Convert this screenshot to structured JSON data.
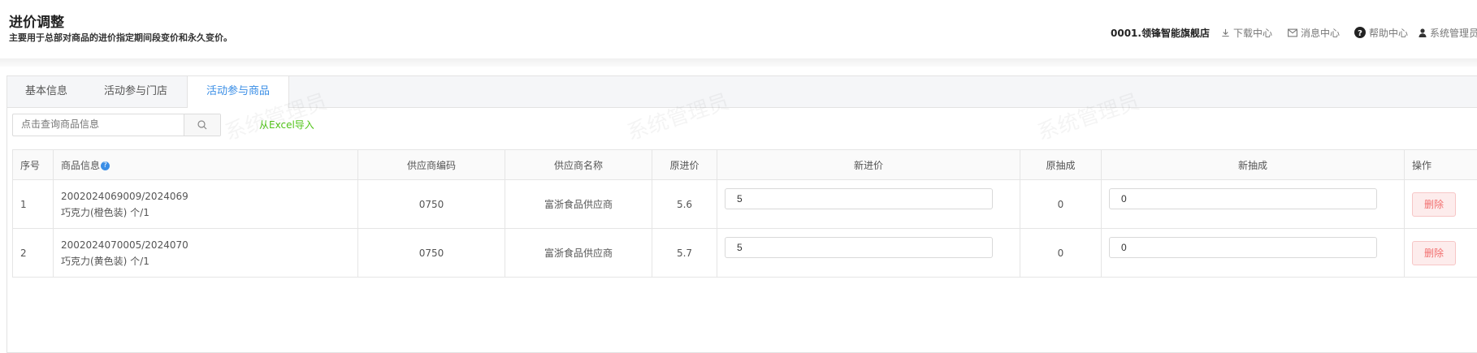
{
  "header": {
    "title": "进价调整",
    "subtitle": "主要用于总部对商品的进价指定期间段变价和永久变价。",
    "store": "0001.领锋智能旗舰店",
    "links": {
      "download": "下载中心",
      "messages": "消息中心",
      "help": "帮助中心",
      "user": "系统管理员"
    }
  },
  "tabs": [
    "基本信息",
    "活动参与门店",
    "活动参与商品"
  ],
  "active_tab": "活动参与商品",
  "search": {
    "placeholder": "点击查询商品信息",
    "value": ""
  },
  "import_label": "从Excel导入",
  "watermark": "系统管理员",
  "table": {
    "headers": {
      "seq": "序号",
      "product": "商品信息",
      "supplier_code": "供应商编码",
      "supplier_name": "供应商名称",
      "old_price": "原进价",
      "new_price": "新进价",
      "old_commission": "原抽成",
      "new_commission": "新抽成",
      "action": "操作"
    },
    "rows": [
      {
        "seq": "1",
        "code": "2002024069009/2024069",
        "name": "巧克力(橙色装) 个/1",
        "supplier_code": "0750",
        "supplier_name": "富浙食品供应商",
        "old_price": "5.6",
        "new_price": "5",
        "old_commission": "0",
        "new_commission": "0",
        "action": "删除"
      },
      {
        "seq": "2",
        "code": "2002024070005/2024070",
        "name": "巧克力(黄色装) 个/1",
        "supplier_code": "0750",
        "supplier_name": "富浙食品供应商",
        "old_price": "5.7",
        "new_price": "5",
        "old_commission": "0",
        "new_commission": "0",
        "action": "删除"
      }
    ]
  },
  "colors": {
    "accent": "#3a8ee6",
    "import": "#52c41a",
    "delete_text": "#f26e6e",
    "delete_bg": "#fdecec"
  }
}
